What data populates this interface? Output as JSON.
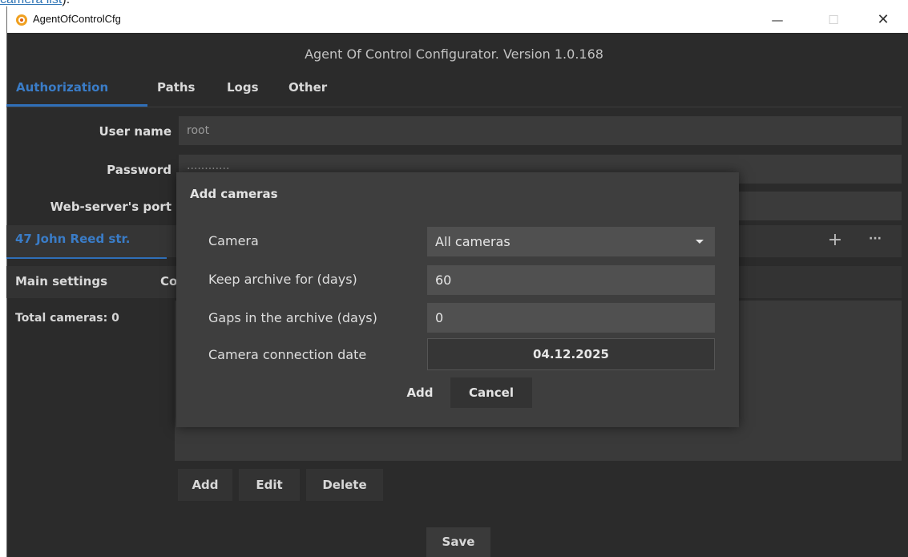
{
  "top_link": {
    "text": "camera list",
    "after": ")."
  },
  "window": {
    "title": "AgentOfControlCfg",
    "controls": {
      "minimize": "—",
      "maximize": "☐",
      "close": "✕"
    }
  },
  "header": {
    "title": "Agent Of Control Configurator. Version 1.0.168"
  },
  "tabs": [
    "Authorization",
    "Paths",
    "Logs",
    "Other"
  ],
  "form": {
    "username_label": "User name",
    "username_value": "root",
    "password_label": "Password",
    "password_value": "············",
    "port_label": "Web-server's port",
    "port_value": ""
  },
  "site": {
    "tab_label": "47 John Reed str.",
    "add_icon": "+",
    "more_icon": "···"
  },
  "subtabs": [
    "Main settings",
    "Co"
  ],
  "cameras": {
    "total_label": "Total cameras: 0"
  },
  "list_buttons": {
    "add": "Add",
    "edit": "Edit",
    "delete": "Delete"
  },
  "save_button": "Save",
  "dialog": {
    "title": "Add cameras",
    "camera_label": "Camera",
    "camera_value": "All cameras",
    "keep_label": "Keep archive for (days)",
    "keep_value": "60",
    "gaps_label": "Gaps in the archive (days)",
    "gaps_value": "0",
    "date_label": "Camera connection date",
    "date_value": "04.12.2025",
    "add_button": "Add",
    "cancel_button": "Cancel"
  },
  "colors": {
    "background": "#2b2b2b",
    "accent": "#3a7cc7",
    "dialog": "#3e3e3e",
    "field": "#3b3b3b"
  }
}
